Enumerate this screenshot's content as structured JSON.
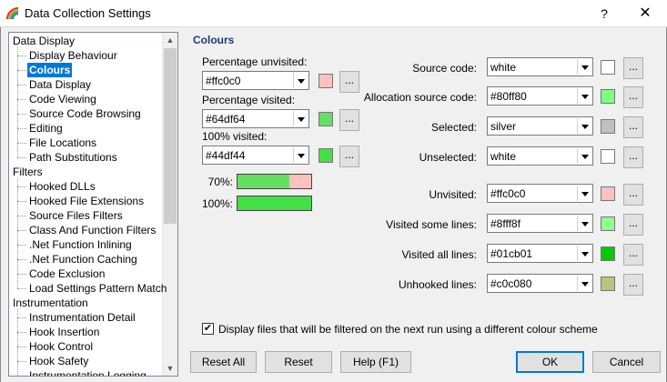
{
  "window": {
    "title": "Data Collection Settings",
    "help_glyph": "?",
    "close_glyph": "✕"
  },
  "tree": {
    "items": [
      {
        "label": "Data Display",
        "level": 0
      },
      {
        "label": "Display Behaviour",
        "level": 1
      },
      {
        "label": "Colours",
        "level": 1,
        "selected": true
      },
      {
        "label": "Data Display",
        "level": 1
      },
      {
        "label": "Code Viewing",
        "level": 1
      },
      {
        "label": "Source Code Browsing",
        "level": 1
      },
      {
        "label": "Editing",
        "level": 1
      },
      {
        "label": "File Locations",
        "level": 1
      },
      {
        "label": "Path Substitutions",
        "level": 1
      },
      {
        "label": "Filters",
        "level": 0
      },
      {
        "label": "Hooked DLLs",
        "level": 1
      },
      {
        "label": "Hooked File Extensions",
        "level": 1
      },
      {
        "label": "Source Files Filters",
        "level": 1
      },
      {
        "label": "Class And Function Filters",
        "level": 1
      },
      {
        "label": ".Net Function Inlining",
        "level": 1
      },
      {
        "label": ".Net Function Caching",
        "level": 1
      },
      {
        "label": "Code Exclusion",
        "level": 1
      },
      {
        "label": "Load Settings Pattern Match",
        "level": 1
      },
      {
        "label": "Instrumentation",
        "level": 0
      },
      {
        "label": "Instrumentation Detail",
        "level": 1
      },
      {
        "label": "Hook Insertion",
        "level": 1
      },
      {
        "label": "Hook Control",
        "level": 1
      },
      {
        "label": "Hook Safety",
        "level": 1
      },
      {
        "label": "Instrumentation Logging",
        "level": 1
      }
    ],
    "scroll_up": "▲",
    "scroll_down": "▼"
  },
  "colours": {
    "title": "Colours",
    "left": [
      {
        "label": "Percentage unvisited:",
        "value": "#ffc0c0",
        "color": "#ffc0c0"
      },
      {
        "label": "Percentage visited:",
        "value": "#64df64",
        "color": "#64df64"
      },
      {
        "label": "100% visited:",
        "value": "#44df44",
        "color": "#44df44"
      }
    ],
    "bars": [
      {
        "label": "70%:",
        "fraction": 0.7,
        "fill": "#64df64",
        "rest": "#ffc0c0"
      },
      {
        "label": "100%:",
        "fraction": 1.0,
        "fill": "#44df44",
        "rest": "#ffc0c0"
      }
    ],
    "right": [
      {
        "label": "Source code:",
        "value": "white",
        "color": "#ffffff"
      },
      {
        "label": "Allocation source code:",
        "value": "#80ff80",
        "color": "#80ff80"
      },
      {
        "label": "Selected:",
        "value": "silver",
        "color": "#c0c0c0"
      },
      {
        "label": "Unselected:",
        "value": "white",
        "color": "#ffffff"
      },
      {
        "label": "Unvisited:",
        "value": "#ffc0c0",
        "color": "#ffc0c0"
      },
      {
        "label": "Visited some lines:",
        "value": "#8fff8f",
        "color": "#8fff8f"
      },
      {
        "label": "Visited all lines:",
        "value": "#01cb01",
        "color": "#01cb01"
      },
      {
        "label": "Unhooked lines:",
        "value": "#c0c080",
        "color": "#c0c080"
      }
    ],
    "dots": "...",
    "checkbox": {
      "checked": true,
      "mark": "✔",
      "label": "Display files that will be filtered on the next run using a different colour scheme"
    }
  },
  "buttons": {
    "reset_all": "Reset All",
    "reset": "Reset",
    "help": "Help (F1)",
    "ok": "OK",
    "cancel": "Cancel"
  }
}
